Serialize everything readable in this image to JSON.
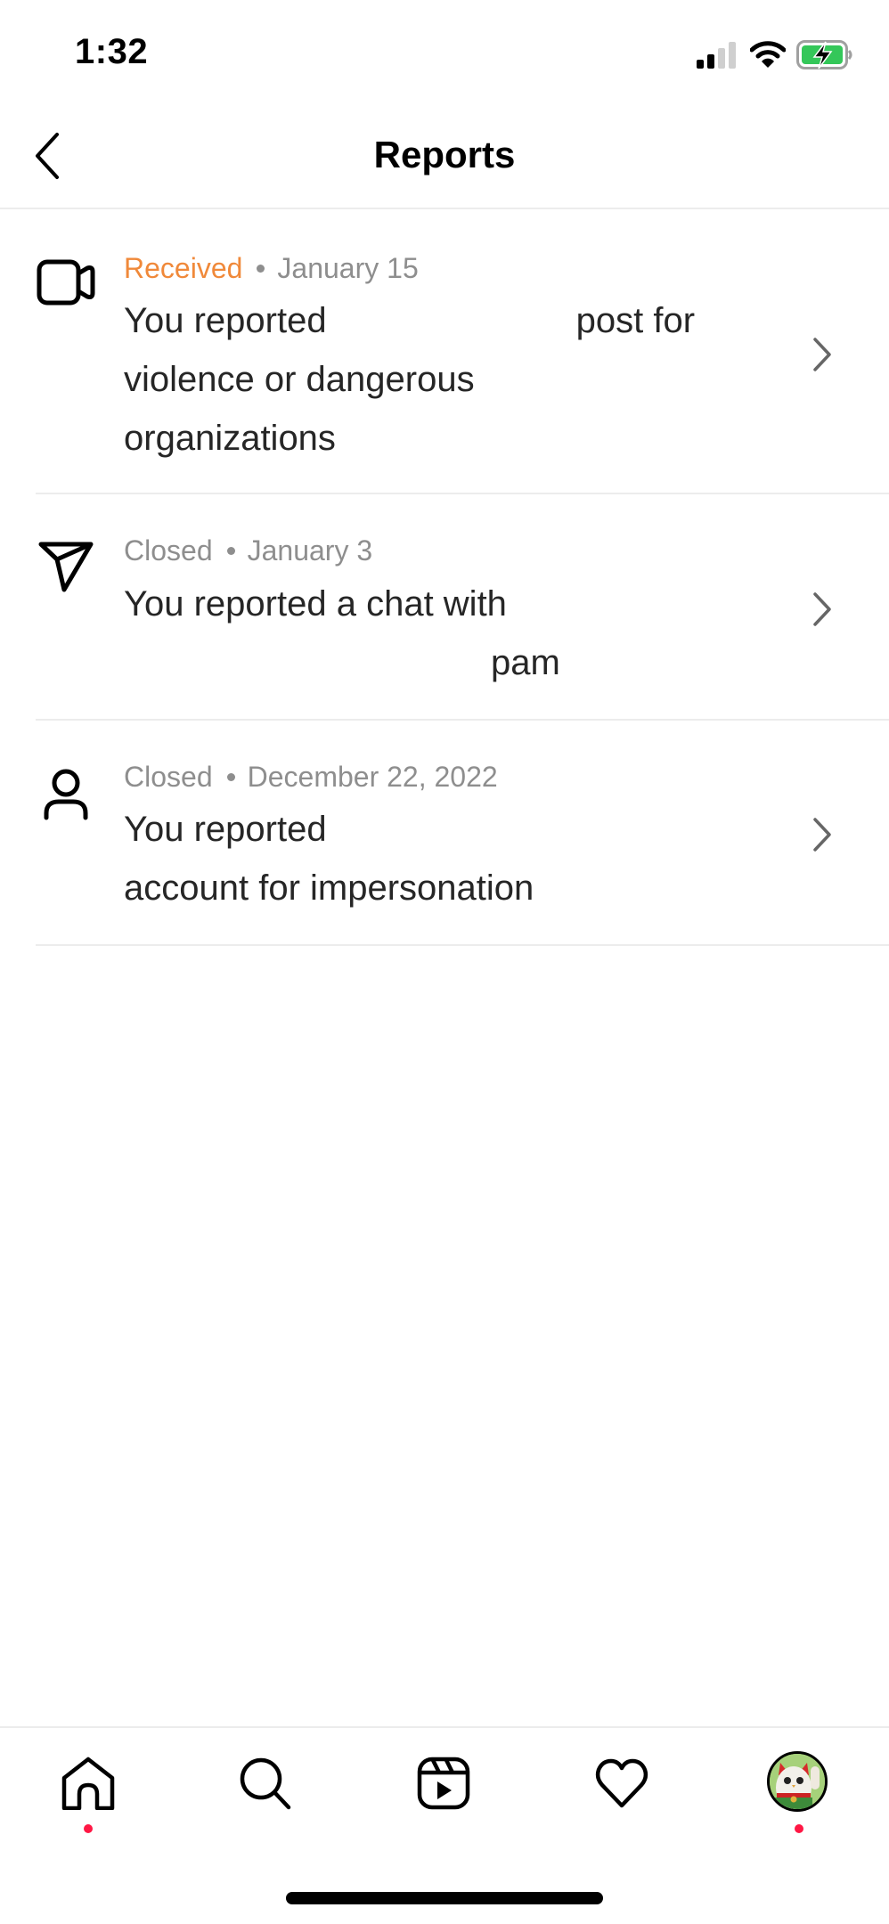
{
  "status_bar": {
    "time": "1:32",
    "signal_icon": "cellular-signal-2-of-4",
    "wifi_icon": "wifi-full",
    "battery_icon": "battery-charging",
    "battery_color": "#34c759"
  },
  "header": {
    "back_icon": "chevron-left",
    "title": "Reports"
  },
  "reports": [
    {
      "icon": "video-camera",
      "status": "Received",
      "status_color": "#f0893a",
      "separator": "•",
      "date": "January 15",
      "body_lines": [
        "You reported",
        "post for",
        "violence or dangerous",
        "organizations"
      ]
    },
    {
      "icon": "paper-plane",
      "status": "Closed",
      "status_color": "#8e8e8e",
      "separator": "•",
      "date": "January 3",
      "body_lines": [
        "You reported a chat with",
        "pam"
      ]
    },
    {
      "icon": "person",
      "status": "Closed",
      "status_color": "#8e8e8e",
      "separator": "•",
      "date": "December 22, 2022",
      "body_lines": [
        "You reported",
        "account for impersonation"
      ]
    }
  ],
  "tab_bar": {
    "items": [
      {
        "name": "home",
        "icon": "home",
        "badge": true
      },
      {
        "name": "search",
        "icon": "search",
        "badge": false
      },
      {
        "name": "reels",
        "icon": "reels",
        "badge": false
      },
      {
        "name": "activity",
        "icon": "heart",
        "badge": false
      },
      {
        "name": "profile",
        "icon": "avatar-lucky-cat",
        "badge": true
      }
    ],
    "badge_color": "#ff1744"
  }
}
